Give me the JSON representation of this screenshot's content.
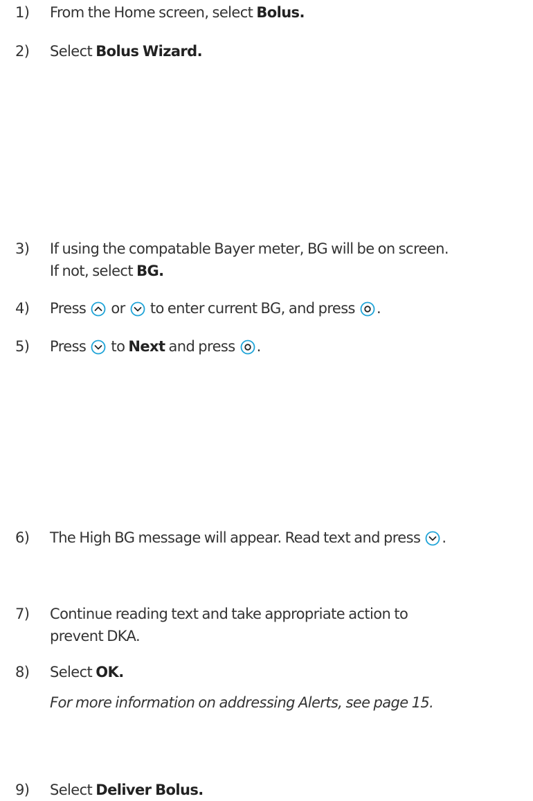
{
  "accent_color": "#1fa4d8",
  "steps": {
    "s1": {
      "num": "1)",
      "text": "From the Home screen, select ",
      "bold": "Bolus."
    },
    "s2": {
      "num": "2)",
      "text": "Select ",
      "bold": "Bolus Wizard."
    },
    "s3": {
      "num": "3)",
      "line1": "If using the compatable Bayer meter, BG will be on screen.",
      "line2_text": "If not, select ",
      "line2_bold": "BG."
    },
    "s4": {
      "num": "4)",
      "t1": "Press ",
      "t2": " or ",
      "t3": " to enter current BG, and press ",
      "t4": "."
    },
    "s5": {
      "num": "5)",
      "t1": "Press ",
      "t2": " to ",
      "bold": "Next",
      "t3": " and press ",
      "t4": "."
    },
    "s6": {
      "num": "6)",
      "t1": "The High BG message will appear.  Read text and press ",
      "t2": "."
    },
    "s7": {
      "num": "7)",
      "line1": "Continue reading text and take appropriate action to",
      "line2": "prevent DKA."
    },
    "s8": {
      "num": "8)",
      "text": "Select ",
      "bold": "OK.",
      "note": "For more information on addressing Alerts, see page 15."
    },
    "s9": {
      "num": "9)",
      "text": "Select ",
      "bold": "Deliver Bolus."
    }
  },
  "icons": {
    "up": "up-arrow-circle-icon",
    "down": "down-arrow-circle-icon",
    "select": "select-button-circle-icon"
  }
}
